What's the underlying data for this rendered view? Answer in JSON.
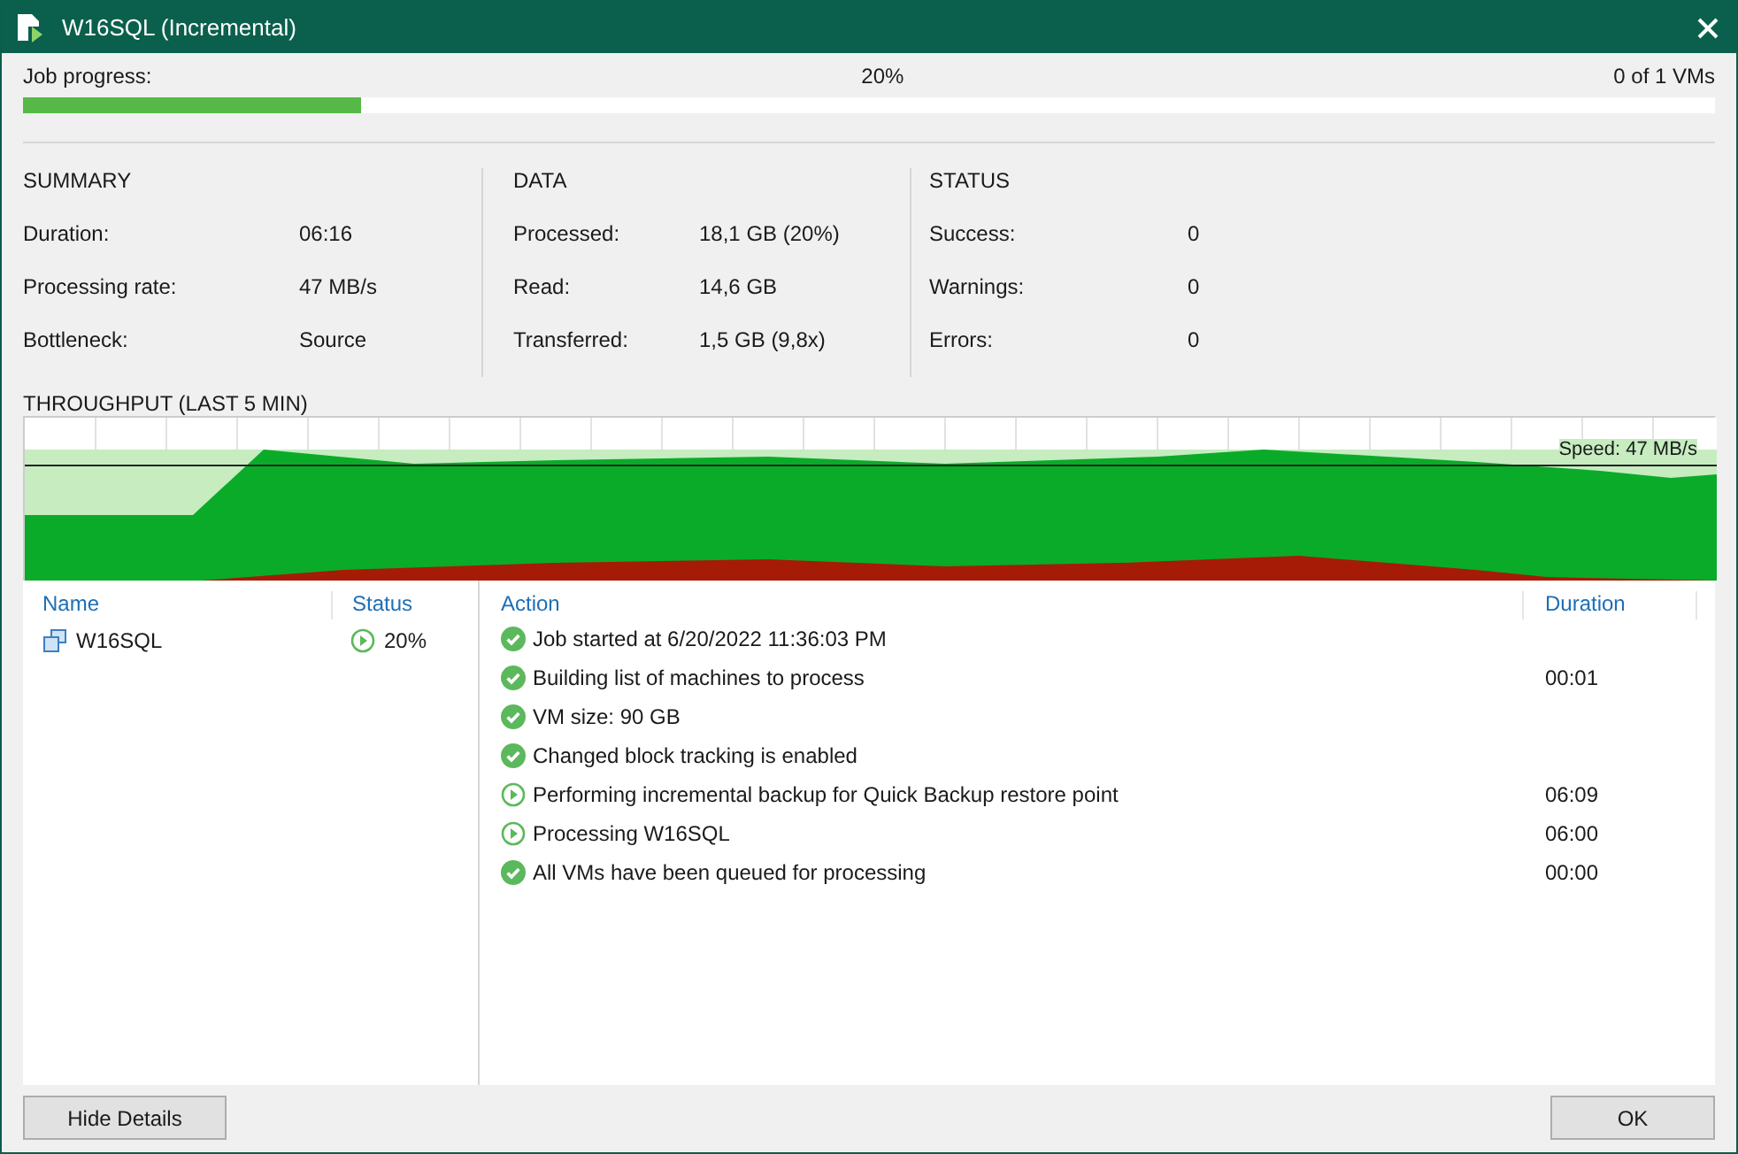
{
  "window": {
    "title": "W16SQL (Incremental)"
  },
  "progress": {
    "label": "Job progress:",
    "percent": "20%",
    "level": 0.2,
    "count": "0 of 1 VMs"
  },
  "summary": {
    "title": "SUMMARY",
    "rows": [
      {
        "label": "Duration:",
        "value": "06:16"
      },
      {
        "label": "Processing rate:",
        "value": "47 MB/s"
      },
      {
        "label": "Bottleneck:",
        "value": "Source"
      }
    ]
  },
  "data": {
    "title": "DATA",
    "rows": [
      {
        "label": "Processed:",
        "value": "18,1 GB (20%)"
      },
      {
        "label": "Read:",
        "value": "14,6 GB"
      },
      {
        "label": "Transferred:",
        "value": "1,5 GB (9,8x)"
      }
    ]
  },
  "status": {
    "title": "STATUS",
    "rows": [
      {
        "label": "Success:",
        "value": "0"
      },
      {
        "label": "Warnings:",
        "value": "0"
      },
      {
        "label": "Errors:",
        "value": "0"
      }
    ]
  },
  "throughput": {
    "title": "THROUGHPUT (LAST 5 MIN)",
    "speed": "Speed: 47 MB/s"
  },
  "vm_table": {
    "columns": [
      "Name",
      "Status"
    ],
    "rows": [
      {
        "name": "W16SQL",
        "status": "20%",
        "kind": "running"
      }
    ]
  },
  "action_table": {
    "columns": [
      "Action",
      "Duration"
    ],
    "rows": [
      {
        "action": "Job started at 6/20/2022 11:36:03 PM",
        "duration": "",
        "kind": "success"
      },
      {
        "action": "Building list of machines to process",
        "duration": "00:01",
        "kind": "success"
      },
      {
        "action": "VM size: 90 GB",
        "duration": "",
        "kind": "success"
      },
      {
        "action": "Changed block tracking is enabled",
        "duration": "",
        "kind": "success"
      },
      {
        "action": "Performing incremental backup for Quick Backup restore point",
        "duration": "06:09",
        "kind": "running"
      },
      {
        "action": "Processing W16SQL",
        "duration": "06:00",
        "kind": "running"
      },
      {
        "action": "All VMs have been queued for processing",
        "duration": "00:00",
        "kind": "success"
      }
    ]
  },
  "buttons": {
    "left": "Hide Details",
    "right": "OK"
  }
}
